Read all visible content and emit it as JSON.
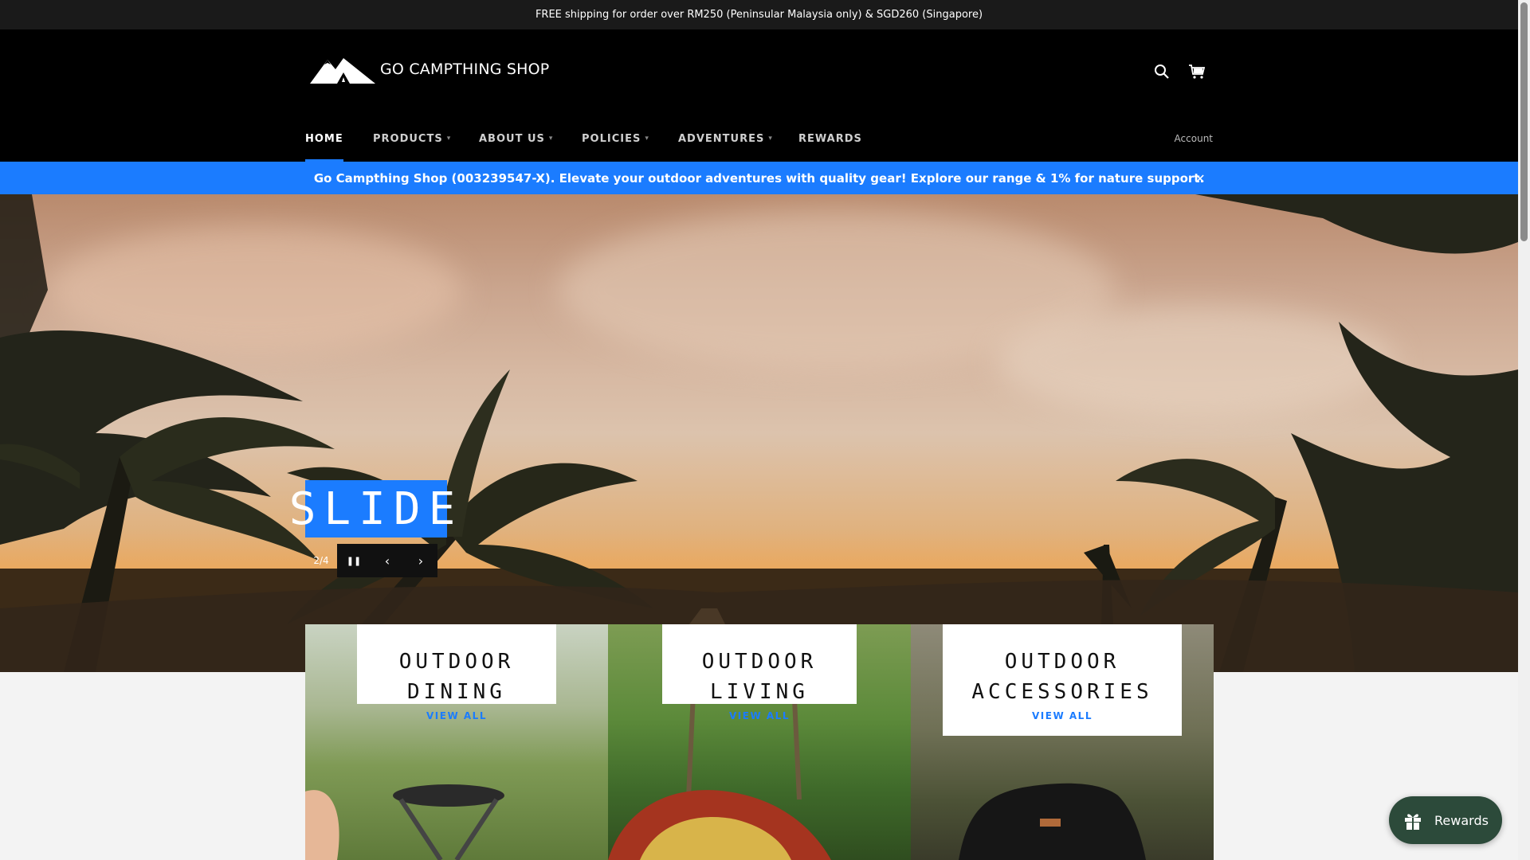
{
  "announcement": {
    "text": "FREE shipping for order over RM250 (Peninsular Malaysia only) & SGD260 (Singapore)"
  },
  "header": {
    "logo_text": "GO CAMPTHING SHOP",
    "icons": [
      "search-icon",
      "cart-icon"
    ]
  },
  "nav": {
    "items": [
      {
        "label": "HOME",
        "active": true,
        "dropdown": false
      },
      {
        "label": "PRODUCTS",
        "active": false,
        "dropdown": true
      },
      {
        "label": "ABOUT US",
        "active": false,
        "dropdown": true
      },
      {
        "label": "POLICIES",
        "active": false,
        "dropdown": true
      },
      {
        "label": "ADVENTURES",
        "active": false,
        "dropdown": true
      },
      {
        "label": "REWARDS",
        "active": false,
        "dropdown": false
      }
    ],
    "account_label": "Account"
  },
  "notice": {
    "text": "Go Campthing Shop (003239547-X). Elevate your outdoor adventures with quality gear! Explore our range & 1% for nature support.",
    "close_icon": "close-icon"
  },
  "hero": {
    "slide_title": "SLIDE",
    "slide_counter": "2/4",
    "controls": [
      "pause-icon",
      "chevron-left-icon",
      "chevron-right-icon"
    ]
  },
  "collections": [
    {
      "title": "OUTDOOR DINING",
      "link": "VIEW ALL"
    },
    {
      "title": "OUTDOOR LIVING",
      "link": "VIEW ALL"
    },
    {
      "title": "OUTDOOR ACCESSORIES",
      "link": "VIEW ALL"
    }
  ],
  "rewards_widget": {
    "label": "Rewards",
    "icon": "gift-icon"
  },
  "colors": {
    "accent": "#1b7cff",
    "header_bg": "#000000",
    "announce_bg": "#1a1a1a",
    "rewards_bg": "#2c4a3a"
  }
}
